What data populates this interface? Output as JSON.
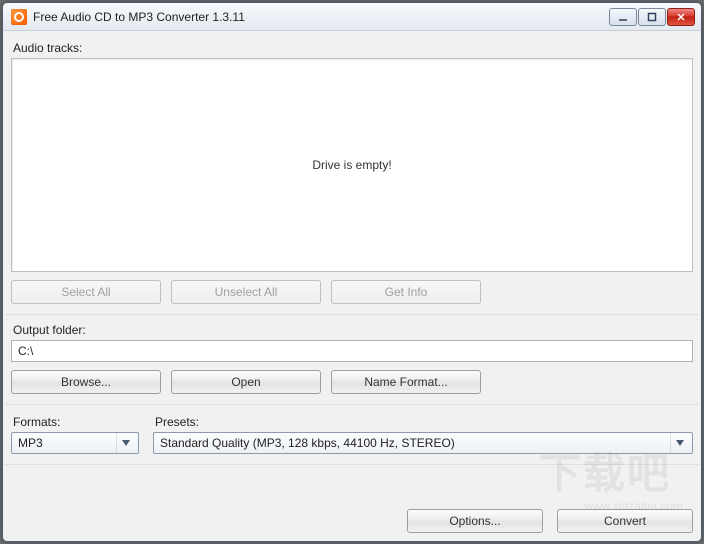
{
  "window": {
    "title": "Free Audio CD to MP3 Converter 1.3.11"
  },
  "sections": {
    "audio_tracks_label": "Audio tracks:",
    "drive_empty": "Drive is empty!",
    "output_folder_label": "Output folder:",
    "output_folder_value": "C:\\",
    "formats_label": "Formats:",
    "presets_label": "Presets:"
  },
  "buttons": {
    "select_all": "Select All",
    "unselect_all": "Unselect All",
    "get_info": "Get Info",
    "browse": "Browse...",
    "open": "Open",
    "name_format": "Name Format...",
    "options": "Options...",
    "convert": "Convert"
  },
  "combos": {
    "formats_value": "MP3",
    "presets_value": "Standard Quality (MP3, 128 kbps, 44100 Hz, STEREO)"
  }
}
